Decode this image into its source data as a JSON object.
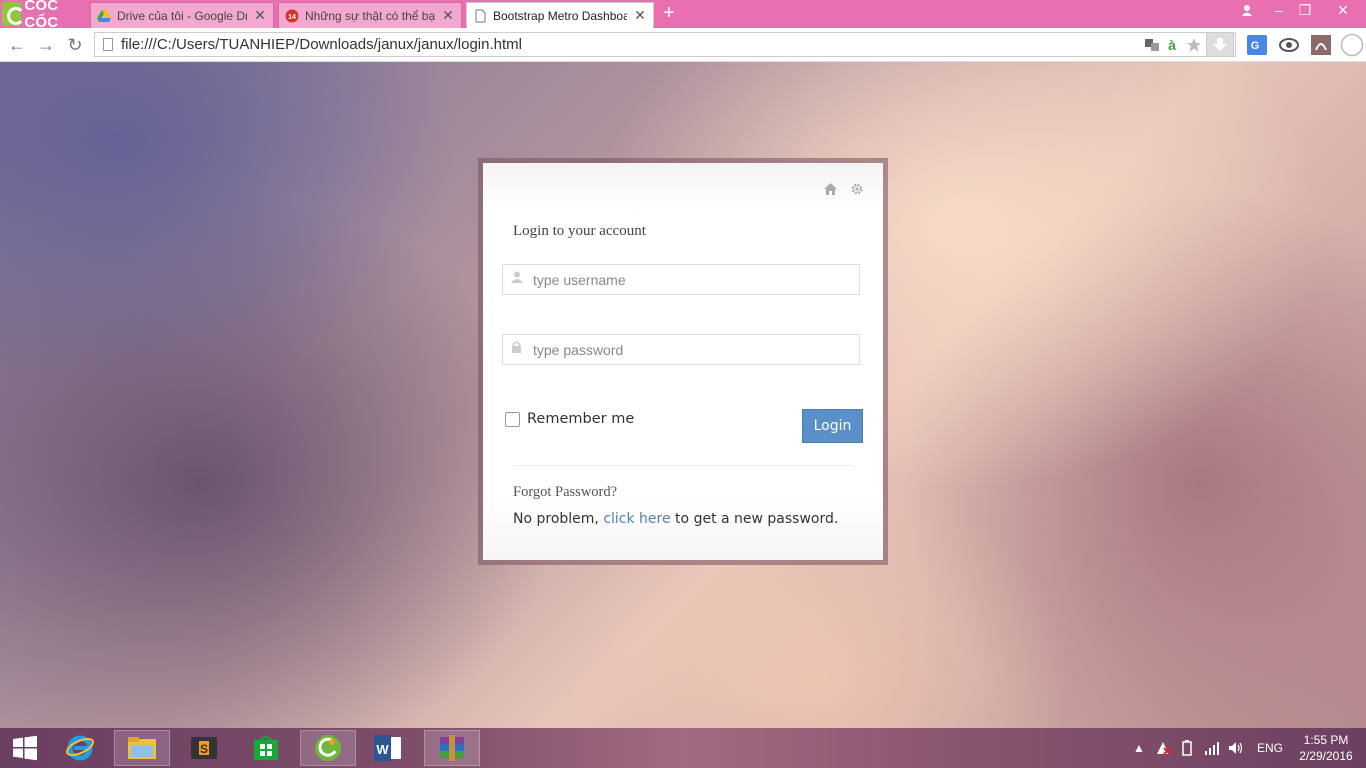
{
  "browser": {
    "brand": "CỐC CỐC",
    "tabs": [
      {
        "title": "Drive của tôi - Google Dri",
        "icon": "google-drive-icon"
      },
      {
        "title": "Những sự thật có thể bạn",
        "icon": "news-14-icon"
      },
      {
        "title": "Bootstrap Metro Dashboa",
        "icon": "page-icon",
        "active": true
      }
    ],
    "url": "file:///C:/Users/TUANHIEP/Downloads/janux/janux/login.html"
  },
  "login": {
    "title": "Login to your account",
    "username_placeholder": "type username",
    "password_placeholder": "type password",
    "remember_label": "Remember me",
    "login_button": "Login",
    "forgot_title": "Forgot Password?",
    "forgot_prefix": "No problem, ",
    "forgot_link": "click here",
    "forgot_suffix": " to get a new password."
  },
  "taskbar": {
    "language": "ENG",
    "time": "1:55 PM",
    "date": "2/29/2016"
  },
  "colors": {
    "tabbar": "#e86fb0",
    "login_button": "#5b8fc7",
    "link": "#5a7fa8"
  }
}
